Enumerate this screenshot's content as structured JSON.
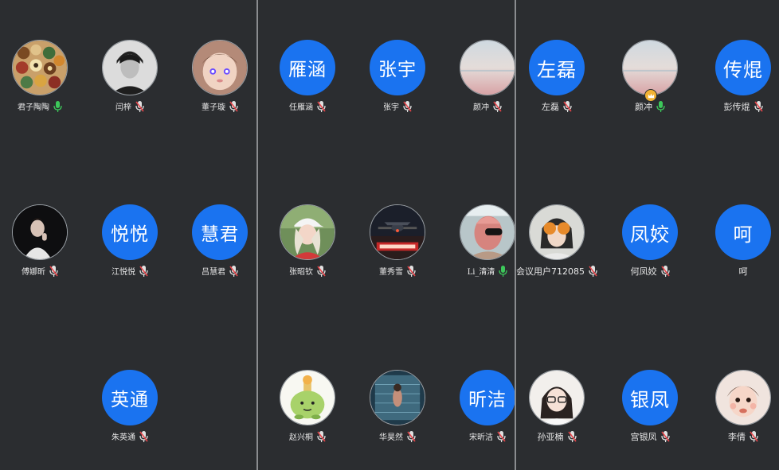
{
  "colors": {
    "background": "#2b2d30",
    "avatar_blue": "#1a73f0",
    "divider": "#8a8c8f",
    "mic_on": "#3cc85a",
    "mic_muted": "#e0e0e0",
    "mic_slash": "#e8454a",
    "host_badge": "#f2b233"
  },
  "panels": [
    {
      "participants": [
        {
          "name": "君子陶陶",
          "avatar_type": "photo",
          "avatar_icon": "colorful-pattern-photo",
          "mic": "on"
        },
        {
          "name": "闫梓",
          "avatar_type": "photo",
          "avatar_icon": "young-man-photo",
          "mic": "muted"
        },
        {
          "name": "董子璇",
          "avatar_type": "photo",
          "avatar_icon": "child-photo",
          "mic": "muted"
        },
        {
          "name": "傅娜昕",
          "avatar_type": "photo",
          "avatar_icon": "dark-portrait-photo",
          "mic": "muted"
        },
        {
          "name": "江悦悦",
          "avatar_type": "text",
          "avatar_text": "悦悦",
          "mic": "muted"
        },
        {
          "name": "吕慧君",
          "avatar_type": "text",
          "avatar_text": "慧君",
          "mic": "muted"
        },
        {
          "name": "朱英通",
          "avatar_type": "text",
          "avatar_text": "英通",
          "mic": "muted"
        }
      ]
    },
    {
      "participants": [
        {
          "name": "任雁涵",
          "avatar_type": "text",
          "avatar_text": "雁涵",
          "mic": "muted"
        },
        {
          "name": "张宇",
          "avatar_type": "text",
          "avatar_text": "张宇",
          "mic": "muted"
        },
        {
          "name": "颜冲",
          "avatar_type": "photo",
          "avatar_icon": "sky-gradient-photo",
          "mic": "muted"
        },
        {
          "name": "张昭钦",
          "avatar_type": "photo",
          "avatar_icon": "girl-cap-photo",
          "mic": "muted"
        },
        {
          "name": "董秀雪",
          "avatar_type": "photo",
          "avatar_icon": "airplane-photo",
          "mic": "muted"
        },
        {
          "name": "Li_清清",
          "avatar_type": "photo",
          "avatar_icon": "pink-mask-photo",
          "mic": "on"
        },
        {
          "name": "赵兴桐",
          "avatar_type": "photo",
          "avatar_icon": "cartoon-plant-photo",
          "mic": "muted"
        },
        {
          "name": "华昊然",
          "avatar_type": "photo",
          "avatar_icon": "pool-photo",
          "mic": "muted"
        },
        {
          "name": "宋昕洁",
          "avatar_type": "text",
          "avatar_text": "昕洁",
          "mic": "muted"
        }
      ]
    },
    {
      "participants": [
        {
          "name": "左磊",
          "avatar_type": "text",
          "avatar_text": "左磊",
          "mic": "muted"
        },
        {
          "name": "颜冲",
          "avatar_type": "photo",
          "avatar_icon": "sky-gradient-photo",
          "mic": "on",
          "host": true
        },
        {
          "name": "彭传焜",
          "avatar_type": "text",
          "avatar_text": "传焜",
          "mic": "muted"
        },
        {
          "name": "会议用户712085",
          "avatar_type": "photo",
          "avatar_icon": "woman-fruit-photo",
          "mic": "muted"
        },
        {
          "name": "何凤姣",
          "avatar_type": "text",
          "avatar_text": "凤姣",
          "mic": "muted"
        },
        {
          "name": "呵",
          "avatar_type": "text",
          "avatar_text": "呵",
          "mic": "none"
        },
        {
          "name": "孙亚楠",
          "avatar_type": "photo",
          "avatar_icon": "girl-glasses-photo",
          "mic": "muted"
        },
        {
          "name": "宫银凤",
          "avatar_type": "text",
          "avatar_text": "银凤",
          "mic": "muted"
        },
        {
          "name": "李倩",
          "avatar_type": "photo",
          "avatar_icon": "toddler-photo",
          "mic": "muted"
        }
      ]
    }
  ]
}
